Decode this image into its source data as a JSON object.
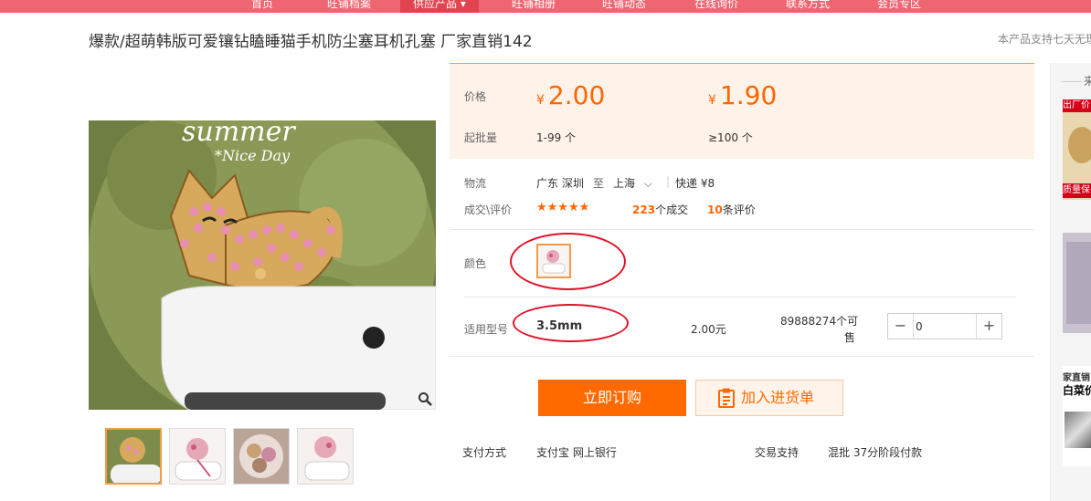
{
  "nav": {
    "items": [
      "首页",
      "旺铺档案",
      "供应产品",
      "旺铺相册",
      "旺铺动态",
      "在线询价",
      "联系方式",
      "会员专区"
    ]
  },
  "product": {
    "title": "爆款/超萌韩版可爱镶钻瞌睡猫手机防尘塞耳机孔塞 厂家直销142",
    "notice": "本产品支持七天无理由"
  },
  "image": {
    "text_summer": "summer",
    "text_niceday": "*Nice Day"
  },
  "pricing": {
    "price_label": "价格",
    "moq_label": "起批量",
    "currency": "¥",
    "tiers": [
      {
        "price": "2.00",
        "range": "1-99 个"
      },
      {
        "price": "1.90",
        "range": "≥100 个"
      }
    ]
  },
  "logistics": {
    "label": "物流",
    "from": "广东 深圳",
    "to_word": "至",
    "to": "上海",
    "shipping": "快递 ¥8"
  },
  "deals": {
    "label": "成交\\评价",
    "stars": "★★★★★",
    "deals_count": "223",
    "deals_suffix": "个成交",
    "reviews_count": "10",
    "reviews_suffix": "条评价"
  },
  "color": {
    "label": "颜色"
  },
  "model": {
    "label": "适用型号",
    "name": "3.5mm",
    "price": "2.00元",
    "stock_line1": "89888274个可",
    "stock_line2": "售",
    "quantity": "0",
    "minus": "−",
    "plus": "+"
  },
  "actions": {
    "buy_now": "立即订购",
    "add_to_list": "加入进货单"
  },
  "payment": {
    "label": "支付方式",
    "methods": "支付宝 网上银行",
    "trade_label": "交易支持",
    "trade_methods": "混批 37分阶段付款"
  },
  "sidebar": {
    "title": "来",
    "badge1_top": "出厂价",
    "badge1_bottom": "质量保",
    "badge3_top": "家直销",
    "badge3_bottom": "白菜价"
  },
  "colors": {
    "brand_orange": "#ff6600",
    "nav_pink": "#ee6671",
    "annotation_red": "#e3112a"
  }
}
